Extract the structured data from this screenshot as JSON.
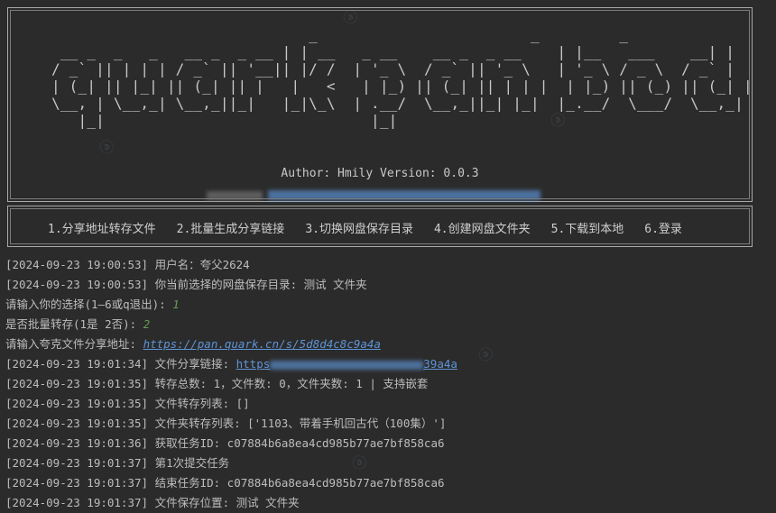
{
  "banner": {
    "ascii_art": "                             _                        _         _\n __ _  _   _   __ _  _ __ | | __   _ __    __ _  _ __    | |__   ___    __| |\n/ _` || | | | / _` || '__|| |/ /  | '_ \\  / _` || '_ \\   | '_ \\ / _ \\  / _` |\n| (_| || |_| || (_| || |   |   <   | |_) || (_| || | | |  | |_) || (_) || (_| |\n\\__, | \\__,_| \\__,_||_|   |_|\\_\\  | .__/  \\__,_||_| |_|  |_.__/  \\___/  \\__,_|\n   |_|                              |_|",
    "author_line": "Author: Hmily  Version: 0.0.3"
  },
  "menu": {
    "items": [
      "1.分享地址转存文件",
      "2.批量生成分享链接",
      "3.切换网盘保存目录",
      "4.创建网盘文件夹",
      "5.下载到本地",
      "6.登录"
    ]
  },
  "console": {
    "lines": [
      {
        "ts": "[2024-09-23 19:00:53]",
        "text": " 用户名：夸父2624"
      },
      {
        "ts": "[2024-09-23 19:00:53]",
        "text": " 你当前选择的网盘保存目录: 测试 文件夹"
      },
      {
        "prompt": "请输入你的选择(1—6或q退出): ",
        "answer": "1"
      },
      {
        "prompt": "是否批量转存(1是 2否): ",
        "answer": "2"
      },
      {
        "prompt": "请输入夸克文件分享地址: ",
        "link": "https://pan.quark.cn/s/5d8d4c8c9a4a"
      },
      {
        "ts": "[2024-09-23 19:01:34]",
        "text": " 文件分享链接: ",
        "link_start": "https",
        "link_end": "39a4a"
      },
      {
        "ts": "[2024-09-23 19:01:35]",
        "text": " 转存总数: 1，文件数: 0，文件夹数: 1 | 支持嵌套"
      },
      {
        "ts": "[2024-09-23 19:01:35]",
        "text": " 文件转存列表: []"
      },
      {
        "ts": "[2024-09-23 19:01:35]",
        "text": " 文件夹转存列表: ['1103、带着手机回古代（100集）']"
      },
      {
        "ts": "[2024-09-23 19:01:36]",
        "text": " 获取任务ID: c07884b6a8ea4cd985b77ae7bf858ca6"
      },
      {
        "ts": "[2024-09-23 19:01:37]",
        "text": " 第1次提交任务"
      },
      {
        "ts": "[2024-09-23 19:01:37]",
        "text": " 结束任务ID: c07884b6a8ea4cd985b77ae7bf858ca6"
      },
      {
        "ts": "[2024-09-23 19:01:37]",
        "text": " 文件保存位置: 测试 文件夹"
      }
    ]
  },
  "colors": {
    "background": "#2b2b2b",
    "text": "#bbbbbb",
    "link": "#5e94d8",
    "input": "#6a9955"
  }
}
